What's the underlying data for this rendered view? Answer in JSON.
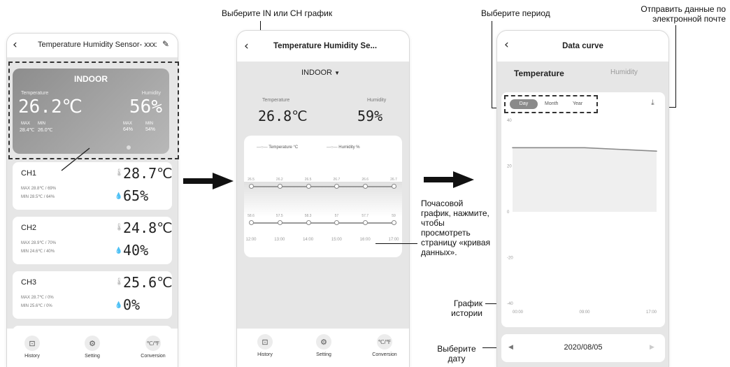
{
  "annotations": {
    "select_chart": "Выберите IN или CH график",
    "select_period": "Выберите период",
    "send_email": "Отправить данные по электронной почте",
    "hourly_chart": "Почасовой график, нажмите, чтобы просмотреть страницу «кривая данных».",
    "history_chart": "График истории",
    "select_date": "Выберите дату"
  },
  "screen1": {
    "title": "Temperature Humidity Sensor- xxxxxx",
    "indoor": {
      "label": "INDOOR",
      "temp_label": "Temperature",
      "hum_label": "Humidity",
      "temp": "26.2℃",
      "hum": "56%",
      "max_label": "MAX",
      "min_label": "MIN",
      "temp_max": "28.4℃",
      "temp_min": "26.0℃",
      "hum_max": "64%",
      "hum_min": "54%"
    },
    "channels": [
      {
        "name": "CH1",
        "max": "MAX 28.8℃ / 69%",
        "min": "MIN 28.5℃ / 64%",
        "temp": "28.7℃",
        "hum": "65%"
      },
      {
        "name": "CH2",
        "max": "MAX 28.9℃ / 70%",
        "min": "MIN 24.6℃ / 40%",
        "temp": "24.8℃",
        "hum": "40%"
      },
      {
        "name": "CH3",
        "max": "MAX 28.7℃ / 0%",
        "min": "MIN 25.6℃ / 0%",
        "temp": "25.6℃",
        "hum": "0%"
      }
    ],
    "tabs": [
      "History",
      "Setting",
      "Conversion"
    ]
  },
  "screen2": {
    "title": "Temperature Humidity Se...",
    "selector": "INDOOR",
    "temp_label": "Temperature",
    "hum_label": "Humidity",
    "temp": "26.8℃",
    "hum": "59%",
    "legend_temp": "Temperature °C",
    "legend_hum": "Humidity %",
    "temp_values": [
      "26.5",
      "26.2",
      "26.5",
      "26.7",
      "26.6",
      "26.7"
    ],
    "hum_values": [
      "58.6",
      "57.5",
      "58.3",
      "57",
      "57.7",
      "59"
    ],
    "times": [
      "12:00",
      "13:00",
      "14:00",
      "15:00",
      "16:00",
      "17:00"
    ],
    "tabs": [
      "History",
      "Setting",
      "Conversion"
    ]
  },
  "screen3": {
    "title": "Data curve",
    "tab_temp": "Temperature",
    "tab_hum": "Humidity",
    "periods": [
      "Day",
      "Month",
      "Year"
    ],
    "yticks": [
      "40",
      "20",
      "0",
      "-20",
      "-40"
    ],
    "xticks": [
      "00:00",
      "09:00",
      "17:00"
    ],
    "date": "2020/08/05"
  },
  "chart_data": {
    "type": "line",
    "x": [
      "00:00",
      "09:00",
      "17:00"
    ],
    "ylim": [
      -40,
      40
    ],
    "series": [
      {
        "values": [
          28,
          28,
          26.5
        ]
      }
    ]
  },
  "colors": {
    "accent": "#8a8a8a",
    "page_bg": "#e6e6e6",
    "arrow": "#111111"
  }
}
